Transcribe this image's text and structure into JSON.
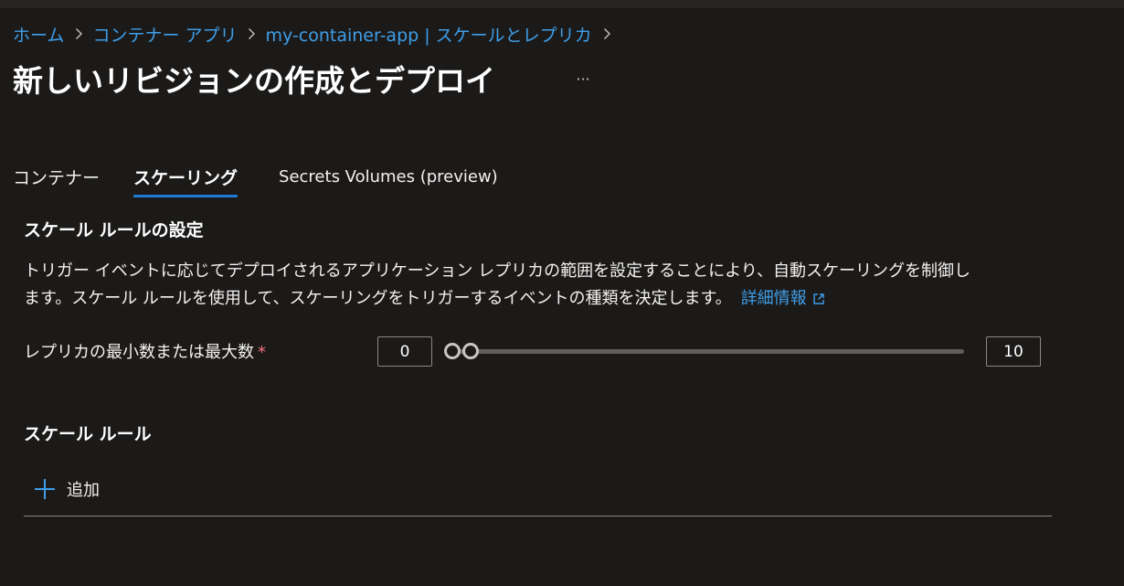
{
  "breadcrumb": {
    "items": [
      "ホーム",
      "コンテナー アプリ",
      "my-container-app | スケールとレプリカ"
    ]
  },
  "page": {
    "title": "新しいリビジョンの作成とデプロイ",
    "more_label": "···"
  },
  "tabs": [
    {
      "label": "コンテナー",
      "active": false
    },
    {
      "label": "スケーリング",
      "active": true
    },
    {
      "label": "Secrets Volumes (preview)",
      "active": false
    }
  ],
  "scale_settings": {
    "heading": "スケール ルールの設定",
    "description_line1": "トリガー イベントに応じてデプロイされるアプリケーション レプリカの範囲を設定することにより、自動スケーリングを制御し",
    "description_line2": "ます。スケール ルールを使用して、スケーリングをトリガーするイベントの種類を決定します。",
    "learn_more": "詳細情報"
  },
  "replicas": {
    "label": "レプリカの最小数または最大数",
    "required_marker": "*",
    "min_value": "0",
    "max_value": "10",
    "slider_min": 0,
    "slider_max": 10
  },
  "scale_rules": {
    "heading": "スケール ルール",
    "add_label": "追加"
  },
  "colors": {
    "background": "#1b1a19",
    "link": "#3f9ee8",
    "accent": "#1f7ad6",
    "required": "#f1707b"
  },
  "icons": {
    "breadcrumb_separator": "chevron-right-icon",
    "external_link": "external-link-icon",
    "add": "plus-icon"
  }
}
